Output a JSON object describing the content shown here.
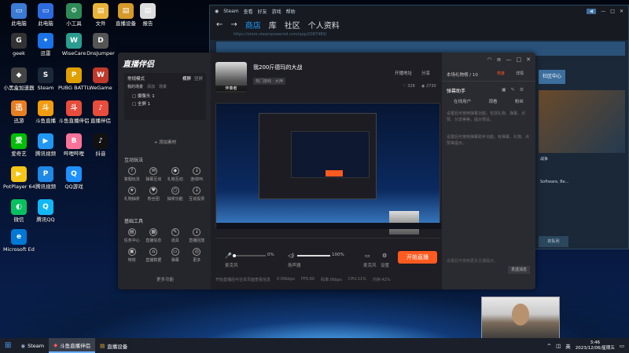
{
  "desktop_icons": [
    {
      "label": "此电脑",
      "color": "#3a7bd5",
      "glyph": "▭"
    },
    {
      "label": "此电脑",
      "color": "#2d6cdf",
      "glyph": "▭"
    },
    {
      "label": "小工具",
      "color": "#2e8b57",
      "glyph": "⚙"
    },
    {
      "label": "文件",
      "color": "#e8b33a",
      "glyph": "▤"
    },
    {
      "label": "直播设备",
      "color": "#d49a2a",
      "glyph": "▤"
    },
    {
      "label": "报告",
      "color": "#dddddd",
      "glyph": "▤"
    },
    {
      "label": "geek",
      "color": "#333",
      "glyph": "G"
    },
    {
      "label": "迅雷",
      "color": "#1a73e8",
      "glyph": "✦"
    },
    {
      "label": "WiseCare",
      "color": "#2a9d8f",
      "glyph": "W"
    },
    {
      "label": "DnsJumper",
      "color": "#555",
      "glyph": "D"
    },
    {
      "label": "小黑盒加速器",
      "color": "#444",
      "glyph": "◆"
    },
    {
      "label": "Steam",
      "color": "#1b2838",
      "glyph": "S"
    },
    {
      "label": "PUBG BATTLEGR...",
      "color": "#e0a000",
      "glyph": "P"
    },
    {
      "label": "WeGame",
      "color": "#c0392b",
      "glyph": "W"
    },
    {
      "label": "迅游",
      "color": "#e67e22",
      "glyph": "迅"
    },
    {
      "label": "斗鱼直播",
      "color": "#f39c12",
      "glyph": "斗"
    },
    {
      "label": "斗鱼直播伴侣",
      "color": "#e74c3c",
      "glyph": "斗"
    },
    {
      "label": "直播伴侣",
      "color": "#e74c3c",
      "glyph": "♪"
    },
    {
      "label": "爱奇艺",
      "color": "#00be06",
      "glyph": "爱"
    },
    {
      "label": "腾讯视频",
      "color": "#2196f3",
      "glyph": "▶"
    },
    {
      "label": "哔哩哔哩",
      "color": "#fb7299",
      "glyph": "B"
    },
    {
      "label": "抖音",
      "color": "#111",
      "glyph": "♪"
    },
    {
      "label": "PotPlayer 64 bit",
      "color": "#f5c518",
      "glyph": "▶"
    },
    {
      "label": "腾讯视频",
      "color": "#1e88e5",
      "glyph": "P"
    },
    {
      "label": "QQ游戏",
      "color": "#1e90ff",
      "glyph": "Q"
    },
    {
      "label": "微信",
      "color": "#07c160",
      "glyph": "◐"
    },
    {
      "label": "腾讯QQ",
      "color": "#12b7f5",
      "glyph": "Q"
    },
    {
      "label": "Microsoft Edge",
      "color": "#0078d4",
      "glyph": "e"
    }
  ],
  "steam": {
    "title": "Steam",
    "menu": [
      "Steam",
      "查看",
      "好友",
      "游戏",
      "帮助"
    ],
    "nav": [
      "商店",
      "库",
      "社区",
      "个人资料"
    ],
    "url": "https://store.steampowered.com/app/2087480/",
    "side_text": [
      "社区中心",
      "战争",
      "Software, Be...",
      "的队列"
    ]
  },
  "app": {
    "logo": "直播伴侣",
    "mode": "常规模式",
    "tabs": [
      "横屏",
      "竖屏"
    ],
    "scene_tabs": [
      "我的场景",
      "添加",
      "场景"
    ],
    "sources": [
      "摄像头 1",
      "全屏 1"
    ],
    "add_source": "+ 添加素材",
    "interact_title": "互动玩法",
    "interact": [
      "答题玩法",
      "弹幕互动",
      "礼物互动",
      "连线PK",
      "礼物抽奖",
      "粉丝团",
      "抽奖功能",
      "互动投票"
    ],
    "basic_title": "基础工具",
    "tools": [
      "任务中心",
      "直播信息",
      "道具",
      "直播回放",
      "特效",
      "直播数据",
      "弹幕",
      "更多"
    ],
    "more": "更多功能",
    "stream_title": "我200斤德玛的大战",
    "streamer": "伴奏者",
    "category": "热门游戏 · 大神",
    "status": "开播地址",
    "share": "分享",
    "stats": [
      "328",
      "2730"
    ],
    "mic": "麦克风",
    "mic_pct": "0%",
    "speaker": "扬声器",
    "speaker_pct": "100%",
    "cam": "麦克风",
    "settings": "设置",
    "start": "开始直播",
    "footer": "开始直播后可在本页面查看信息",
    "footer_stats": [
      "0.00kbps",
      "FPS:60",
      "码率:0kbps",
      "CPU:11%",
      "内存:42%",
      "丢帧:0"
    ]
  },
  "right_panel": {
    "header": "本场礼物榜",
    "count": "/ 10",
    "badge": "热度",
    "more": "详情",
    "assistant": "弹幕助手",
    "tabs": [
      "在线用户",
      "观看",
      "粉丝"
    ],
    "text1": "设置后可使用弹幕功能，包括礼物、弹幕、点赞、分享等等，提示预设。",
    "text2": "设置后可使用弹幕助手功能，有弹幕、礼物、点赞等提示。",
    "input_ph": "设置后可使用更多主播提示。",
    "send": "发送消息"
  },
  "taskbar": {
    "start": "⊞",
    "apps": [
      "Steam",
      "斗鱼直播伴侣",
      "直播设备"
    ],
    "lang": "英",
    "time": "3:46",
    "date": "2023/12/06/星期五"
  },
  "colors": {
    "accent": "#ff5a1f",
    "steam": "#1b2838"
  }
}
